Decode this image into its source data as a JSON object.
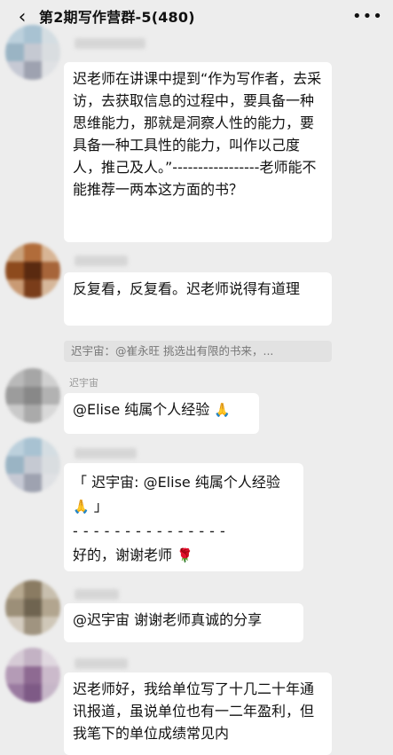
{
  "header": {
    "title": "第2期写作营群-5(480)",
    "back_icon": "‹",
    "more_icon": "•••"
  },
  "messages": [
    {
      "text": "迟老师在讲课中提到“作为写作者，去采访，去获取信息的过程中，要具备一种思维能力，那就是洞察人性的能力，要具备一种工具性的能力，叫作以己度人，推己及人。”",
      "dashes": "-----------------",
      "tail": "老师能不能推荐一两本这方面的书？"
    },
    {
      "text": "反复看，反复看。迟老师说得有道理",
      "quote": "迟宇宙：@崔永旺 挑选出有限的书来，..."
    },
    {
      "sender": "迟宇宙",
      "text": "@Elise  纯属个人经验",
      "emoji": "🙏"
    },
    {
      "quote_line": "「 迟宇宙: @Elise 纯属个人经验",
      "quote_emoji": "🙏",
      "quote_close": "」",
      "dashes": "- - - - - - - - - - - - - - -",
      "reply": "好的，谢谢老师",
      "emoji": "🌹"
    },
    {
      "text": "@迟宇宙  谢谢老师真诚的分享"
    },
    {
      "text": "迟老师好，我给单位写了十几二十年通讯报道，虽说单位也有一二年盈利，但我笔下的单位成绩常见内"
    }
  ]
}
